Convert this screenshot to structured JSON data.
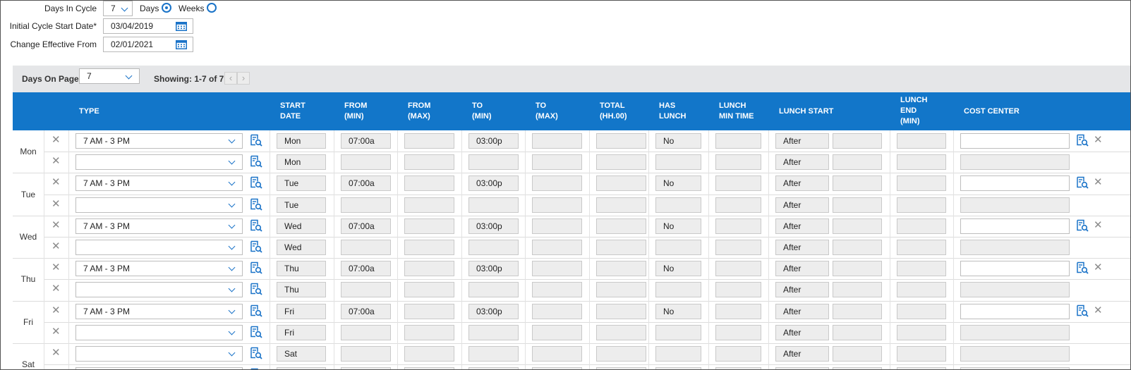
{
  "form": {
    "days_in_cycle_label": "Days In Cycle",
    "days_in_cycle_value": "7",
    "days_radio_label": "Days",
    "weeks_radio_label": "Weeks",
    "initial_start_label": "Initial Cycle Start Date*",
    "initial_start_value": "03/04/2019",
    "change_effective_label": "Change Effective From",
    "change_effective_value": "02/01/2021"
  },
  "pager": {
    "days_on_page_label": "Days On Page",
    "days_on_page_value": "7",
    "showing_text": "Showing: 1-7 of 7",
    "prev_glyph": "‹",
    "next_glyph": "›"
  },
  "columns": {
    "type": "TYPE",
    "start_date": "START\nDATE",
    "from_min": "FROM\n(MIN)",
    "from_max": "FROM\n(MAX)",
    "to_min": "TO\n(MIN)",
    "to_max": "TO\n(MAX)",
    "total": "TOTAL\n(HH.00)",
    "has_lunch": "HAS\nLUNCH",
    "lunch_min_time": "LUNCH\nMIN TIME",
    "lunch_start": "LUNCH START",
    "lunch_end": "LUNCH\nEND\n(MIN)",
    "cost_center": "COST CENTER"
  },
  "days": [
    {
      "label": "Mon",
      "abbr": "Mon",
      "type": "7 AM - 3 PM",
      "from_min": "07:00a",
      "to_min": "03:00p",
      "has_lunch": "No",
      "lunch_start": "After",
      "second_row": true
    },
    {
      "label": "Tue",
      "abbr": "Tue",
      "type": "7 AM - 3 PM",
      "from_min": "07:00a",
      "to_min": "03:00p",
      "has_lunch": "No",
      "lunch_start": "After",
      "second_row": true
    },
    {
      "label": "Wed",
      "abbr": "Wed",
      "type": "7 AM - 3 PM",
      "from_min": "07:00a",
      "to_min": "03:00p",
      "has_lunch": "No",
      "lunch_start": "After",
      "second_row": true
    },
    {
      "label": "Thu",
      "abbr": "Thu",
      "type": "7 AM - 3 PM",
      "from_min": "07:00a",
      "to_min": "03:00p",
      "has_lunch": "No",
      "lunch_start": "After",
      "second_row": true
    },
    {
      "label": "Fri",
      "abbr": "Fri",
      "type": "7 AM - 3 PM",
      "from_min": "07:00a",
      "to_min": "03:00p",
      "has_lunch": "No",
      "lunch_start": "After",
      "second_row": true
    },
    {
      "label": "Sat",
      "abbr": "Sat",
      "type": "",
      "from_min": "",
      "to_min": "",
      "has_lunch": "",
      "lunch_start": "After",
      "second_row": false
    }
  ],
  "icons": {
    "delete": "close-icon",
    "lookup": "search-list-icon",
    "calendar": "calendar-icon",
    "dropdown": "chevron-down-icon"
  },
  "colors": {
    "header_bg": "#1276c9",
    "accent": "#1a73c8",
    "readonly_bg": "#ededed",
    "pager_bg": "#e5e6e8"
  }
}
